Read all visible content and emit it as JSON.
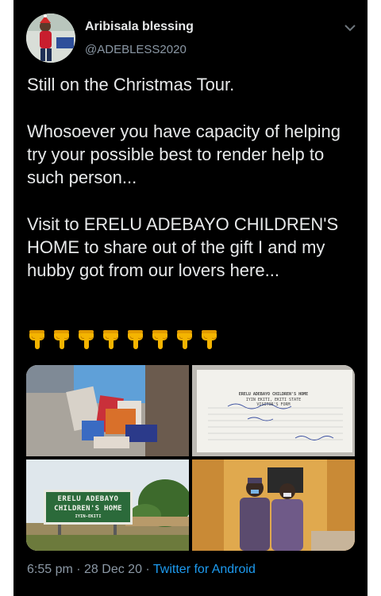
{
  "author": {
    "name": "Aribisala blessing",
    "handle": "@ADEBLESS2020"
  },
  "tweet": {
    "paragraphs": [
      "Still on the Christmas Tour.",
      "Whosoever you have capacity of helping try your possible best to render help to such person...",
      "Visit to ERELU ADEBAYO CHILDREN'S HOME to share out of the gift I and my hubby got from our lovers here..."
    ],
    "emoji_name": "backhand-index-pointing-down",
    "emoji_count": 8
  },
  "media": {
    "document_lines": [
      "ERELU ADEBAYO CHILDREN'S HOME",
      "IYIN EKITI, EKITI STATE",
      "VISITOR'S FORM"
    ],
    "sign_lines": [
      "ERELU ADEBAYO",
      "CHILDREN'S HOME",
      "IYIN-EKITI"
    ]
  },
  "meta": {
    "time": "6:55 pm",
    "separator": " · ",
    "date": "28 Dec 20",
    "source": "Twitter for Android"
  },
  "colors": {
    "background": "#000000",
    "text": "#e7e9ea",
    "muted": "#8b98a5",
    "link": "#1d9bf0"
  }
}
